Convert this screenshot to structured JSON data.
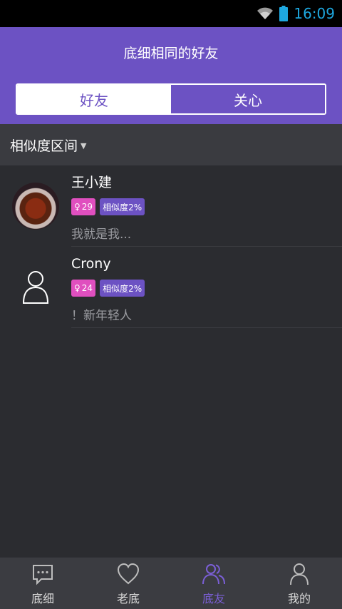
{
  "status": {
    "time": "16:09"
  },
  "header": {
    "title": "底细相同的好友"
  },
  "segmented": {
    "friends_label": "好友",
    "follow_label": "关心"
  },
  "filter": {
    "label": "相似度区间"
  },
  "list": {
    "items": [
      {
        "name": "王小建",
        "age": "29",
        "similarity": "相似度2%",
        "signature": "我就是我...",
        "avatar": "photo"
      },
      {
        "name": "Crony",
        "age": "24",
        "similarity": "相似度2%",
        "signature": "！新年轻人",
        "avatar": "default-person-icon"
      }
    ]
  },
  "tabs": [
    {
      "label": "底细",
      "icon": "chat-bubble-icon"
    },
    {
      "label": "老底",
      "icon": "heart-icon"
    },
    {
      "label": "底友",
      "icon": "friends-icon"
    },
    {
      "label": "我的",
      "icon": "person-icon"
    }
  ],
  "colors": {
    "accent": "#6c52c3",
    "age_tag": "#e04fbf",
    "time": "#1ea8e0"
  }
}
